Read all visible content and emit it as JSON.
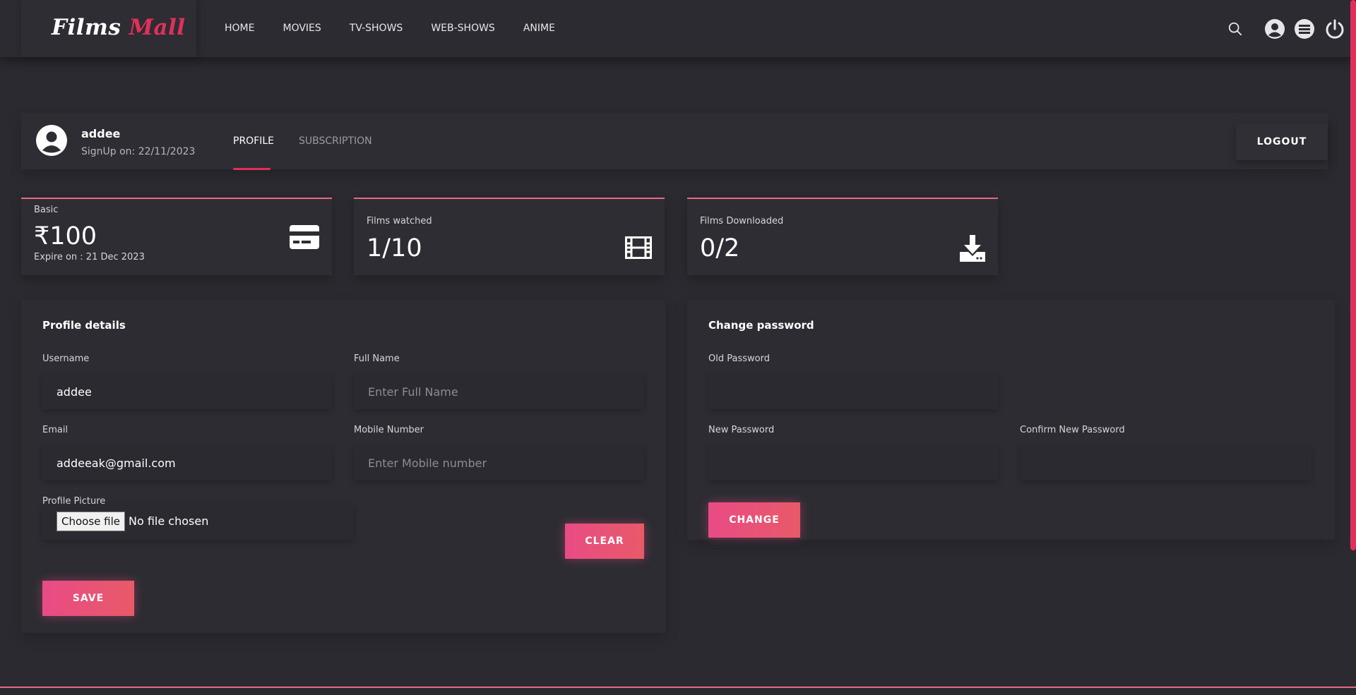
{
  "brand": {
    "part1": "Films",
    "part2": "Mall"
  },
  "nav": {
    "links": [
      "HOME",
      "MOVIES",
      "TV-SHOWS",
      "WEB-SHOWS",
      "ANIME"
    ]
  },
  "icons": {
    "search": "search-icon",
    "account": "account-icon",
    "list": "list-icon",
    "power": "power-icon"
  },
  "profile": {
    "username": "addee",
    "signup": "SignUp on: 22/11/2023",
    "tabs": {
      "profile": "PROFILE",
      "subscription": "SUBSCRIPTION"
    },
    "logout": "LOGOUT"
  },
  "stats": {
    "plan": {
      "label": "Basic",
      "value": "₹100",
      "expire": "Expire on : 21 Dec 2023",
      "icon": "credit-card-icon"
    },
    "watched": {
      "label": "Films watched",
      "value": "1/10",
      "icon": "film-icon"
    },
    "downloaded": {
      "label": "Films Downloaded",
      "value": "0/2",
      "icon": "download-icon"
    }
  },
  "profile_details": {
    "title": "Profile details",
    "username_label": "Username",
    "username_value": "addee",
    "fullname_label": "Full Name",
    "fullname_placeholder": "Enter Full Name",
    "email_label": "Email",
    "email_value": "addeeak@gmail.com",
    "mobile_label": "Mobile Number",
    "mobile_placeholder": "Enter Mobile number",
    "picture_label": "Profile Picture",
    "choose_file": "Choose file",
    "no_file": "No file chosen",
    "clear": "CLEAR",
    "save": "SAVE"
  },
  "change_password": {
    "title": "Change password",
    "old_label": "Old Password",
    "new_label": "New Password",
    "confirm_label": "Confirm New Password",
    "change": "CHANGE"
  },
  "colors": {
    "accent": "#e0305a",
    "button_start": "#e94b85",
    "button_end": "#e85a68",
    "background": "#2a2a30"
  }
}
